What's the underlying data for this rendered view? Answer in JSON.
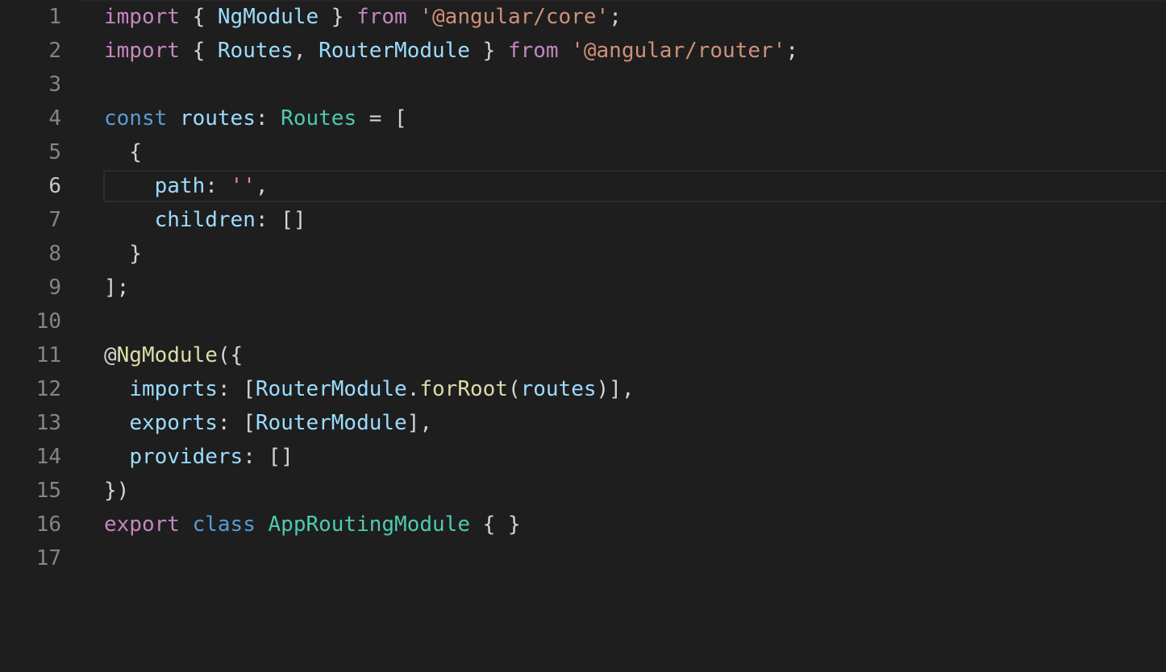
{
  "editor": {
    "theme_colors": {
      "background": "#1e1e1e",
      "line_number": "#858585",
      "keyword_control": "#c586c0",
      "keyword_storage": "#569cd6",
      "string": "#ce9178",
      "type": "#4ec9b0",
      "variable": "#9cdcfe",
      "function": "#dcdcaa",
      "punctuation": "#d4d4d4"
    },
    "active_line_number": "6",
    "lines": [
      {
        "num": "1",
        "tokens": [
          [
            "import",
            "#c586c0"
          ],
          [
            " { ",
            "#d4d4d4"
          ],
          [
            "NgModule",
            "#9cdcfe"
          ],
          [
            " } ",
            "#d4d4d4"
          ],
          [
            "from",
            "#c586c0"
          ],
          [
            " ",
            "#d4d4d4"
          ],
          [
            "'@angular/core'",
            "#ce9178"
          ],
          [
            ";",
            "#d4d4d4"
          ]
        ]
      },
      {
        "num": "2",
        "tokens": [
          [
            "import",
            "#c586c0"
          ],
          [
            " { ",
            "#d4d4d4"
          ],
          [
            "Routes",
            "#9cdcfe"
          ],
          [
            ", ",
            "#d4d4d4"
          ],
          [
            "RouterModule",
            "#9cdcfe"
          ],
          [
            " } ",
            "#d4d4d4"
          ],
          [
            "from",
            "#c586c0"
          ],
          [
            " ",
            "#d4d4d4"
          ],
          [
            "'@angular/router'",
            "#ce9178"
          ],
          [
            ";",
            "#d4d4d4"
          ]
        ]
      },
      {
        "num": "3",
        "tokens": []
      },
      {
        "num": "4",
        "tokens": [
          [
            "const",
            "#569cd6"
          ],
          [
            " ",
            "#d4d4d4"
          ],
          [
            "routes",
            "#9cdcfe"
          ],
          [
            ": ",
            "#d4d4d4"
          ],
          [
            "Routes",
            "#4ec9b0"
          ],
          [
            " = [",
            "#d4d4d4"
          ]
        ]
      },
      {
        "num": "5",
        "tokens": [
          [
            "  {",
            "#d4d4d4"
          ]
        ]
      },
      {
        "num": "6",
        "tokens": [
          [
            "    ",
            "#d4d4d4"
          ],
          [
            "path",
            "#9cdcfe"
          ],
          [
            ": ",
            "#d4d4d4"
          ],
          [
            "''",
            "#ce9178"
          ],
          [
            ",",
            "#d4d4d4"
          ]
        ]
      },
      {
        "num": "7",
        "tokens": [
          [
            "    ",
            "#d4d4d4"
          ],
          [
            "children",
            "#9cdcfe"
          ],
          [
            ": []",
            "#d4d4d4"
          ]
        ]
      },
      {
        "num": "8",
        "tokens": [
          [
            "  }",
            "#d4d4d4"
          ]
        ]
      },
      {
        "num": "9",
        "tokens": [
          [
            "];",
            "#d4d4d4"
          ]
        ]
      },
      {
        "num": "10",
        "tokens": []
      },
      {
        "num": "11",
        "tokens": [
          [
            "@",
            "#d4d4d4"
          ],
          [
            "NgModule",
            "#dcdcaa"
          ],
          [
            "({",
            "#d4d4d4"
          ]
        ]
      },
      {
        "num": "12",
        "tokens": [
          [
            "  ",
            "#d4d4d4"
          ],
          [
            "imports",
            "#9cdcfe"
          ],
          [
            ": [",
            "#d4d4d4"
          ],
          [
            "RouterModule",
            "#9cdcfe"
          ],
          [
            ".",
            "#d4d4d4"
          ],
          [
            "forRoot",
            "#dcdcaa"
          ],
          [
            "(",
            "#d4d4d4"
          ],
          [
            "routes",
            "#9cdcfe"
          ],
          [
            ")],",
            "#d4d4d4"
          ]
        ]
      },
      {
        "num": "13",
        "tokens": [
          [
            "  ",
            "#d4d4d4"
          ],
          [
            "exports",
            "#9cdcfe"
          ],
          [
            ": [",
            "#d4d4d4"
          ],
          [
            "RouterModule",
            "#9cdcfe"
          ],
          [
            "],",
            "#d4d4d4"
          ]
        ]
      },
      {
        "num": "14",
        "tokens": [
          [
            "  ",
            "#d4d4d4"
          ],
          [
            "providers",
            "#9cdcfe"
          ],
          [
            ": []",
            "#d4d4d4"
          ]
        ]
      },
      {
        "num": "15",
        "tokens": [
          [
            "})",
            "#d4d4d4"
          ]
        ]
      },
      {
        "num": "16",
        "tokens": [
          [
            "export",
            "#c586c0"
          ],
          [
            " ",
            "#d4d4d4"
          ],
          [
            "class",
            "#569cd6"
          ],
          [
            " ",
            "#d4d4d4"
          ],
          [
            "AppRoutingModule",
            "#4ec9b0"
          ],
          [
            " { }",
            "#d4d4d4"
          ]
        ]
      },
      {
        "num": "17",
        "tokens": []
      }
    ]
  }
}
